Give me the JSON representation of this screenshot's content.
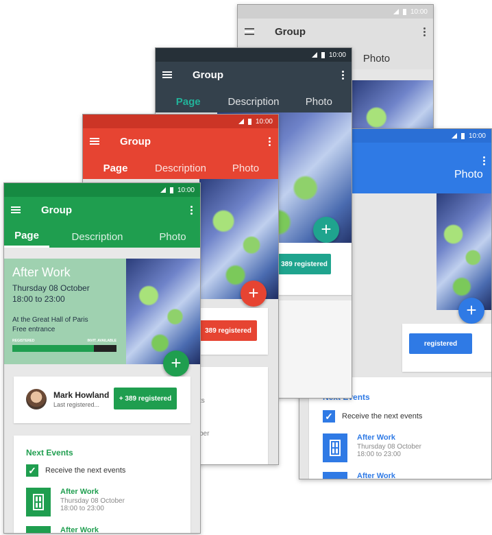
{
  "status_bar": {
    "time": "10:00"
  },
  "toolbar": {
    "title": "Group"
  },
  "tabs": [
    "Page",
    "Description",
    "Photo"
  ],
  "tab_fragment": "an",
  "colors": {
    "green": "#1f9e4f",
    "red": "#e64432",
    "dark": "#34414c",
    "blue": "#2f7ae5",
    "light": "#cfcfcf"
  },
  "event": {
    "title": "After Work",
    "date": "Thursday 08 October",
    "hours": "18:00 to 23:00",
    "location": "At the Great Hall of Paris",
    "entrance": "Free entrance",
    "registered_label": "REGISTERED",
    "available_label": "INVIT. AVAILABLE",
    "progress": 0.78
  },
  "registration": {
    "name": "Mark Howland",
    "subtitle": "Last registered...",
    "button": "+ 389 registered",
    "button_partial": "389 registered",
    "button_partial2": "registered"
  },
  "next_events": {
    "heading": "Next Events",
    "checkbox_label": "Receive the next events",
    "items": [
      {
        "title": "After Work",
        "date": "Thursday 08 October",
        "hours": "18:00 to 23:00"
      },
      {
        "title": "After Work"
      }
    ]
  },
  "fragments": {
    "ents": "ents",
    "ober": "ober",
    "ber": "ber",
    "ts": "ts",
    "er": "er"
  }
}
